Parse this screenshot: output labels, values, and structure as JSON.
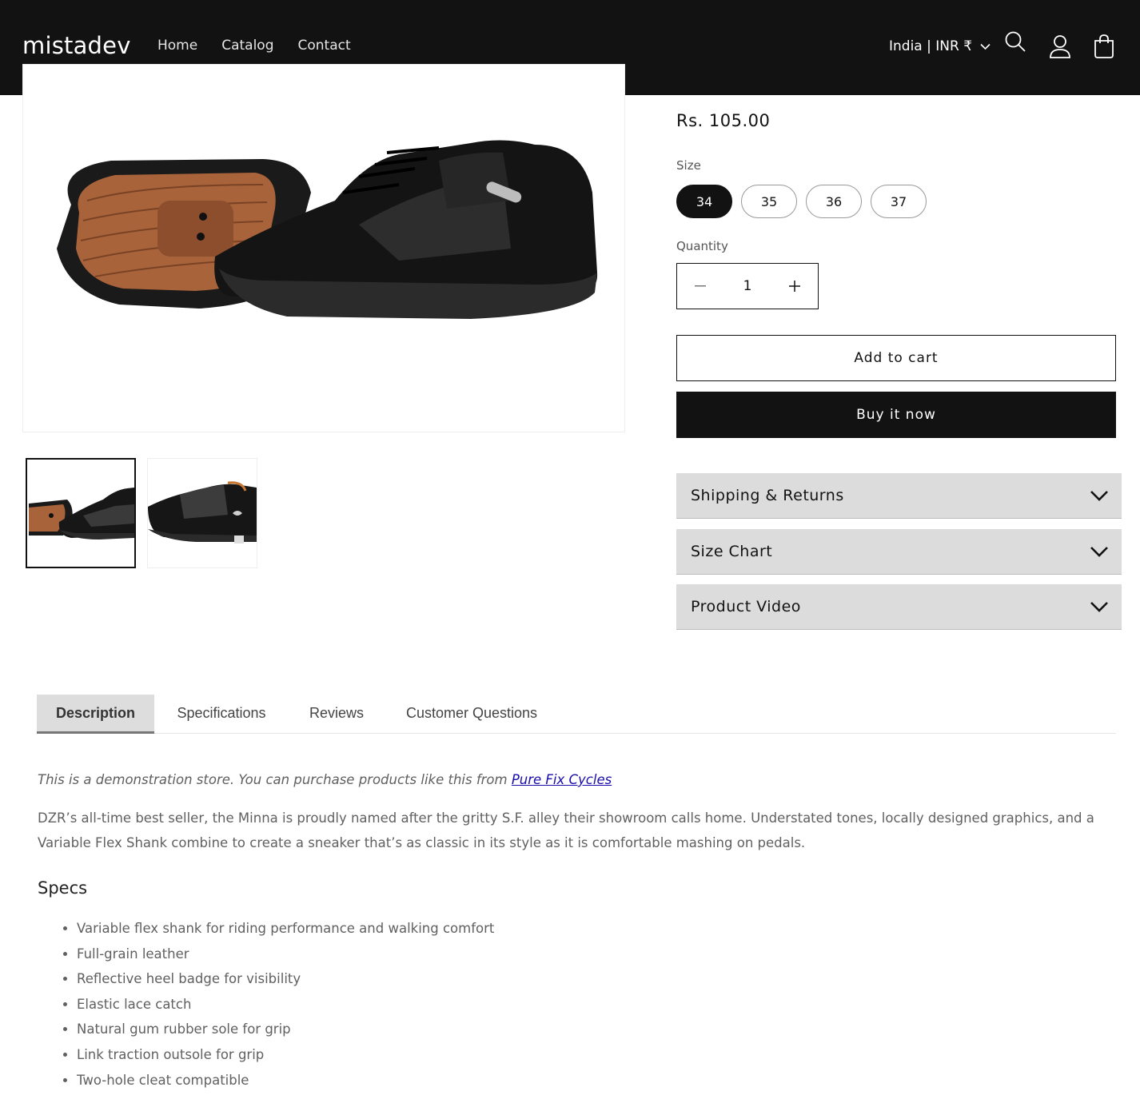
{
  "header": {
    "logo": "mistadev",
    "nav": [
      "Home",
      "Catalog",
      "Contact"
    ],
    "locale": "India | INR ₹",
    "icons": [
      "search-icon",
      "account-icon",
      "cart-icon"
    ]
  },
  "product": {
    "price": "Rs. 105.00",
    "size_label": "Size",
    "sizes": [
      "34",
      "35",
      "36",
      "37"
    ],
    "selected_size": "34",
    "quantity_label": "Quantity",
    "quantity": "1",
    "add_to_cart": "Add to cart",
    "buy_now": "Buy it now",
    "accordions": [
      "Shipping & Returns",
      "Size Chart",
      "Product Video"
    ]
  },
  "gallery": {
    "thumbnail_count": 2,
    "active_thumbnail": 1
  },
  "tabs": {
    "items": [
      "Description",
      "Specifications",
      "Reviews",
      "Customer Questions"
    ],
    "active": "Description"
  },
  "description": {
    "intro_text": "This is a demonstration store. You can purchase products like this from ",
    "intro_link": "Pure Fix Cycles",
    "paragraph": "DZR’s all-time best seller, the Minna is proudly named after the gritty S.F. alley their showroom calls home. Understated tones, locally designed graphics, and a Variable Flex Shank combine to create a sneaker that’s as classic in its style as it is comfortable mashing on pedals.",
    "specs_heading": "Specs",
    "specs": [
      "Variable flex shank for riding performance and walking comfort",
      "Full-grain leather",
      "Reflective heel badge for visibility",
      "Elastic lace catch",
      "Natural gum rubber sole for grip",
      "Link traction outsole for grip",
      "Two-hole cleat compatible"
    ]
  },
  "colors": {
    "dark": "#121212",
    "accordion_bg": "#dcdcdc",
    "link": "#1a0dab"
  }
}
